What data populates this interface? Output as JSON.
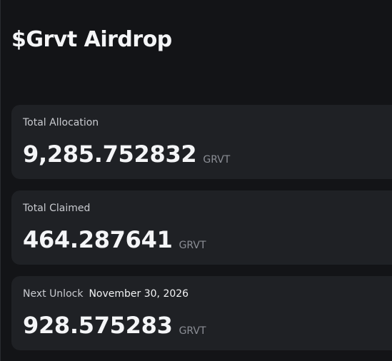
{
  "page": {
    "title": "$Grvt Airdrop"
  },
  "cards": [
    {
      "label": "Total Allocation",
      "value": "9,285.752832",
      "unit": "GRVT"
    },
    {
      "label": "Total Claimed",
      "value": "464.287641",
      "unit": "GRVT"
    },
    {
      "label": "Next Unlock",
      "date": "November 30, 2026",
      "value": "928.575283",
      "unit": "GRVT"
    }
  ],
  "colors": {
    "background": "#131417",
    "card": "#1f2125",
    "text_primary": "#f4f5f7",
    "text_muted": "#8b8e95"
  }
}
